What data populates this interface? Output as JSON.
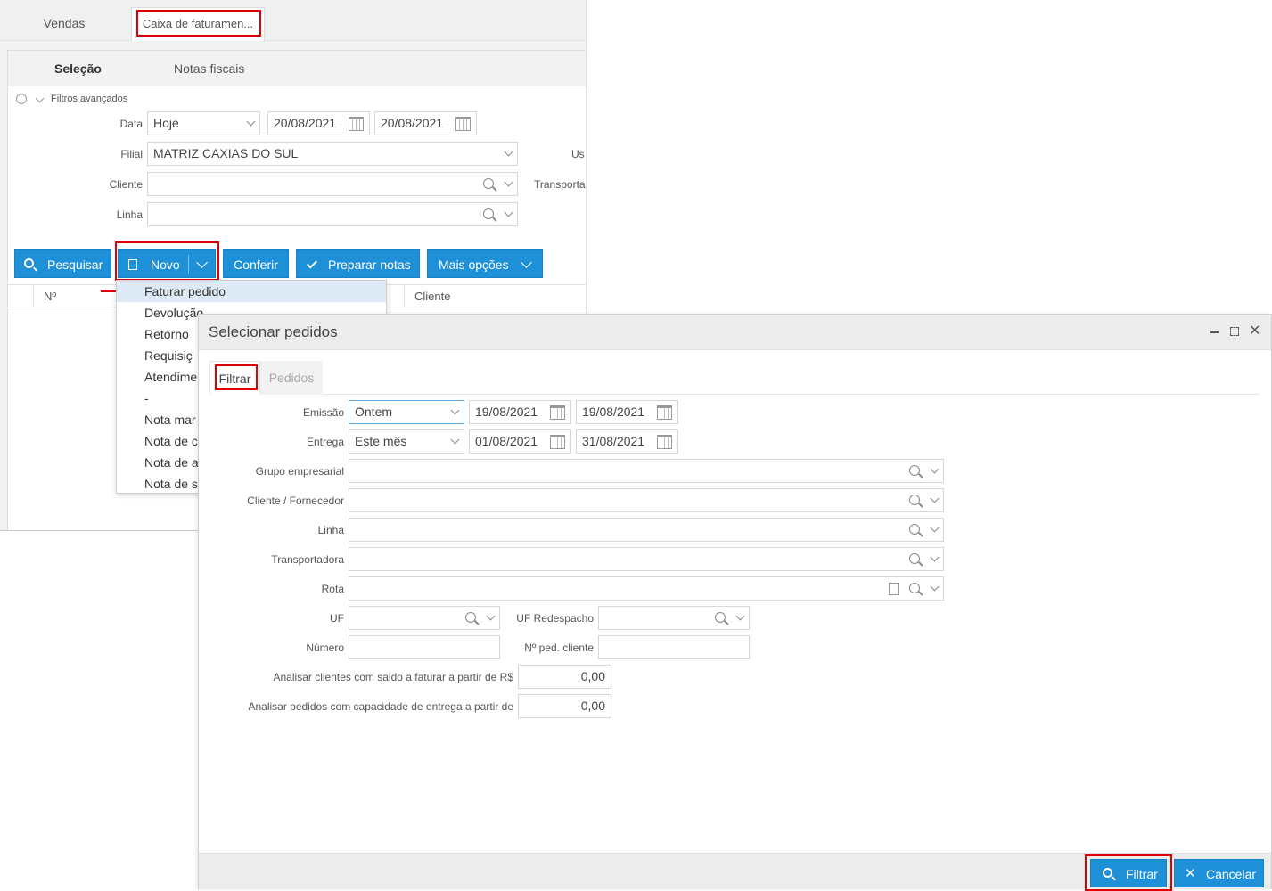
{
  "app": {
    "tabs": [
      "Vendas",
      "Caixa de faturamen..."
    ],
    "subtabs": [
      "Seleção",
      "Notas fiscais"
    ],
    "filters_toggle": "Filtros avançados",
    "filters": {
      "data_label": "Data",
      "data_period": "Hoje",
      "data_from": "20/08/2021",
      "data_to": "20/08/2021",
      "filial_label": "Filial",
      "filial_value": "MATRIZ CAXIAS DO SUL",
      "usuario_label_partial": "Us",
      "cliente_label": "Cliente",
      "transportadora_label_partial": "Transporta",
      "linha_label": "Linha"
    },
    "toolbar": {
      "pesquisar": "Pesquisar",
      "novo": "Novo",
      "conferir": "Conferir",
      "preparar_notas": "Preparar notas",
      "mais_opcoes": "Mais opções"
    },
    "grid": {
      "col_num": "Nº",
      "col_cliente": "Cliente"
    },
    "novo_menu": [
      "Faturar pedido",
      "Devolução",
      "Retorno",
      "Requisiç",
      "Atendime",
      "-",
      "Nota mar",
      "Nota de c",
      "Nota de a",
      "Nota de s"
    ]
  },
  "dialog": {
    "title": "Selecionar pedidos",
    "tabs": [
      "Filtrar",
      "Pedidos"
    ],
    "fields": {
      "emissao_label": "Emissão",
      "emissao_period": "Ontem",
      "emissao_from": "19/08/2021",
      "emissao_to": "19/08/2021",
      "entrega_label": "Entrega",
      "entrega_period": "Este mês",
      "entrega_from": "01/08/2021",
      "entrega_to": "31/08/2021",
      "grupo_label": "Grupo empresarial",
      "cliente_fornecedor_label": "Cliente / Fornecedor",
      "linha_label": "Linha",
      "transportadora_label": "Transportadora",
      "rota_label": "Rota",
      "uf_label": "UF",
      "uf_redespacho_label": "UF Redespacho",
      "numero_label": "Número",
      "ped_cliente_label": "Nº ped. cliente",
      "saldo_label": "Analisar clientes com saldo a faturar a partir de R$",
      "saldo_value": "0,00",
      "capacidade_label": "Analisar pedidos com capacidade de entrega a partir de",
      "capacidade_value": "0,00"
    },
    "footer": {
      "filtrar": "Filtrar",
      "cancelar": "Cancelar"
    }
  },
  "colors": {
    "primary": "#1e90d8",
    "highlight": "#e00000",
    "menu_hover": "#dde9f5"
  }
}
